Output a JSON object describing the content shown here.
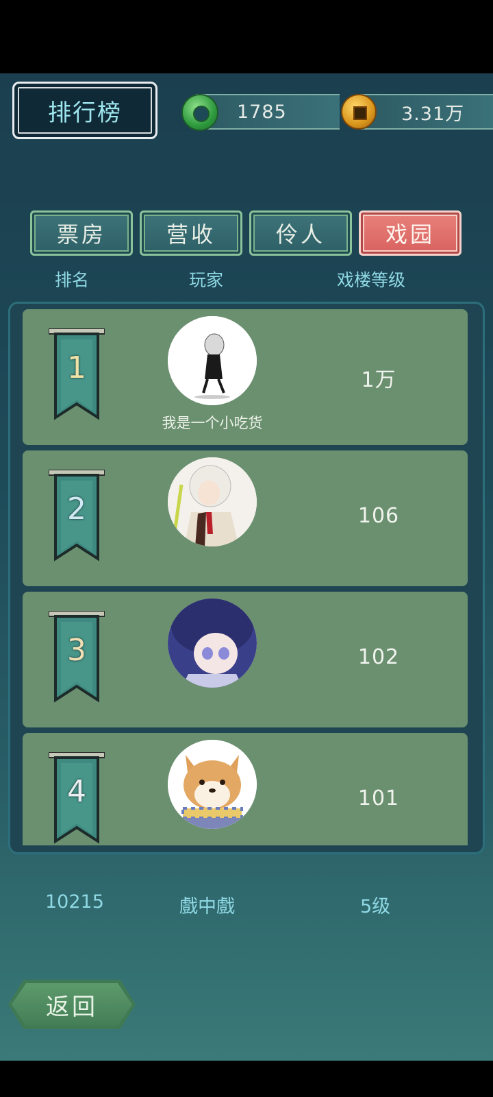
{
  "header": {
    "title": "排行榜",
    "jade_amount": "1785",
    "coin_amount": "3.31万"
  },
  "tabs": [
    {
      "label": "票房",
      "active": false
    },
    {
      "label": "营收",
      "active": false
    },
    {
      "label": "伶人",
      "active": false
    },
    {
      "label": "戏园",
      "active": true
    }
  ],
  "columns": {
    "rank": "排名",
    "player": "玩家",
    "level": "戏楼等级"
  },
  "rows": [
    {
      "rank": "1",
      "name": "我是一个小吃货",
      "level": "1万"
    },
    {
      "rank": "2",
      "name": "",
      "level": "106"
    },
    {
      "rank": "3",
      "name": "",
      "level": "102"
    },
    {
      "rank": "4",
      "name": "",
      "level": "101"
    }
  ],
  "me": {
    "rank": "10215",
    "name": "戲中戲",
    "level": "5级"
  },
  "footer": {
    "back_label": "返回"
  },
  "colors": {
    "active_tab": "#d8615e",
    "row_bg": "#6b9070",
    "header_text": "#8fd9e4"
  }
}
